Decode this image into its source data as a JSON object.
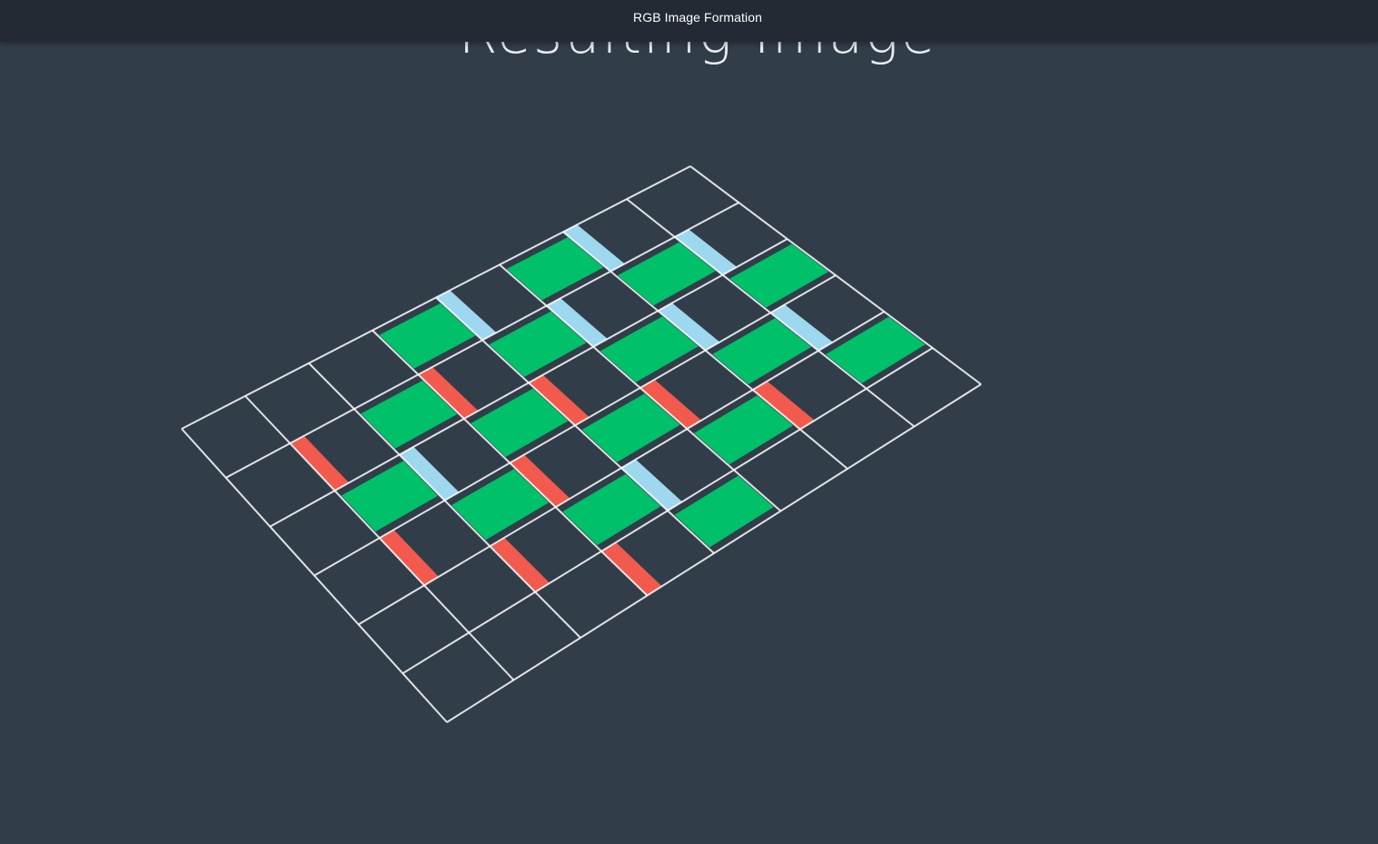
{
  "window": {
    "title": "RGB Image Formation"
  },
  "slide": {
    "heading": "Resulting Image"
  },
  "diagram": {
    "rows": 6,
    "cols": 8,
    "layers": [
      {
        "name": "red",
        "color": "#f25a4e"
      },
      {
        "name": "green",
        "color": "#00c06a"
      },
      {
        "name": "blue",
        "color": "#9dd8ef"
      }
    ],
    "grid_color": "#ffffff",
    "background_color": "#323d4a",
    "pattern": [
      [
        "",
        "",
        "",
        "G",
        "B",
        "G",
        "B",
        ""
      ],
      [
        "",
        "R",
        "G",
        "R",
        "G",
        "B",
        "G",
        "B"
      ],
      [
        "",
        "G",
        "B",
        "G",
        "R",
        "G",
        "B",
        "G"
      ],
      [
        "",
        "R",
        "G",
        "R",
        "G",
        "R",
        "G",
        "B"
      ],
      [
        "",
        "",
        "R",
        "G",
        "B",
        "G",
        "R",
        "G"
      ],
      [
        "",
        "",
        "",
        "R",
        "G",
        "",
        "",
        ""
      ]
    ]
  }
}
